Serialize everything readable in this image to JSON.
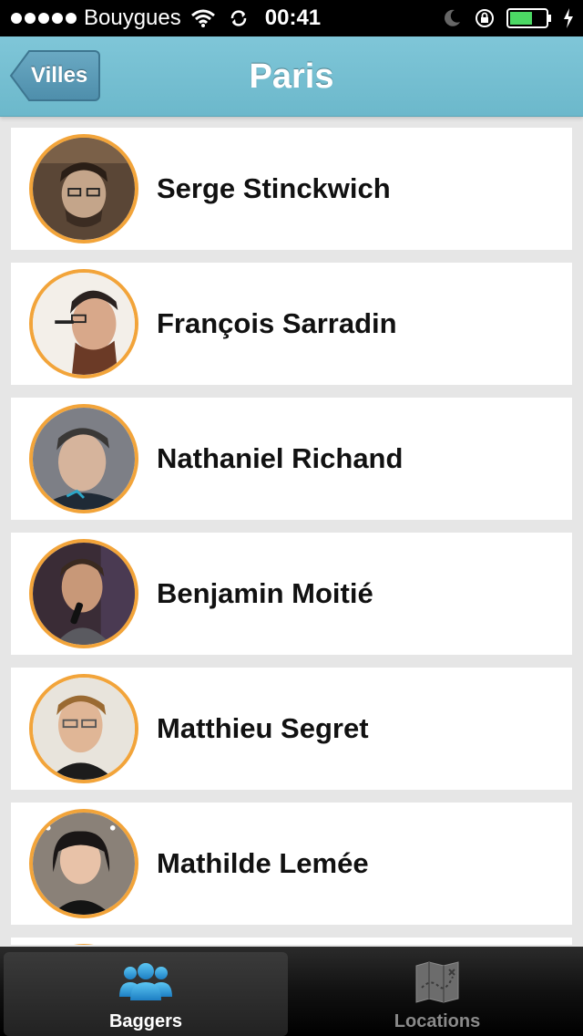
{
  "status_bar": {
    "carrier": "Bouygues",
    "time": "00:41"
  },
  "nav": {
    "back_label": "Villes",
    "title": "Paris"
  },
  "baggers": [
    {
      "name": "Serge Stinckwich"
    },
    {
      "name": "François Sarradin"
    },
    {
      "name": "Nathaniel Richand"
    },
    {
      "name": "Benjamin Moitié"
    },
    {
      "name": "Matthieu Segret"
    },
    {
      "name": "Mathilde Lemée"
    }
  ],
  "tabs": [
    {
      "label": "Baggers",
      "icon": "people-icon",
      "active": true
    },
    {
      "label": "Locations",
      "icon": "map-icon",
      "active": false
    }
  ],
  "colors": {
    "nav_bar": "#74bfd1",
    "avatar_ring": "#f2a43a"
  }
}
